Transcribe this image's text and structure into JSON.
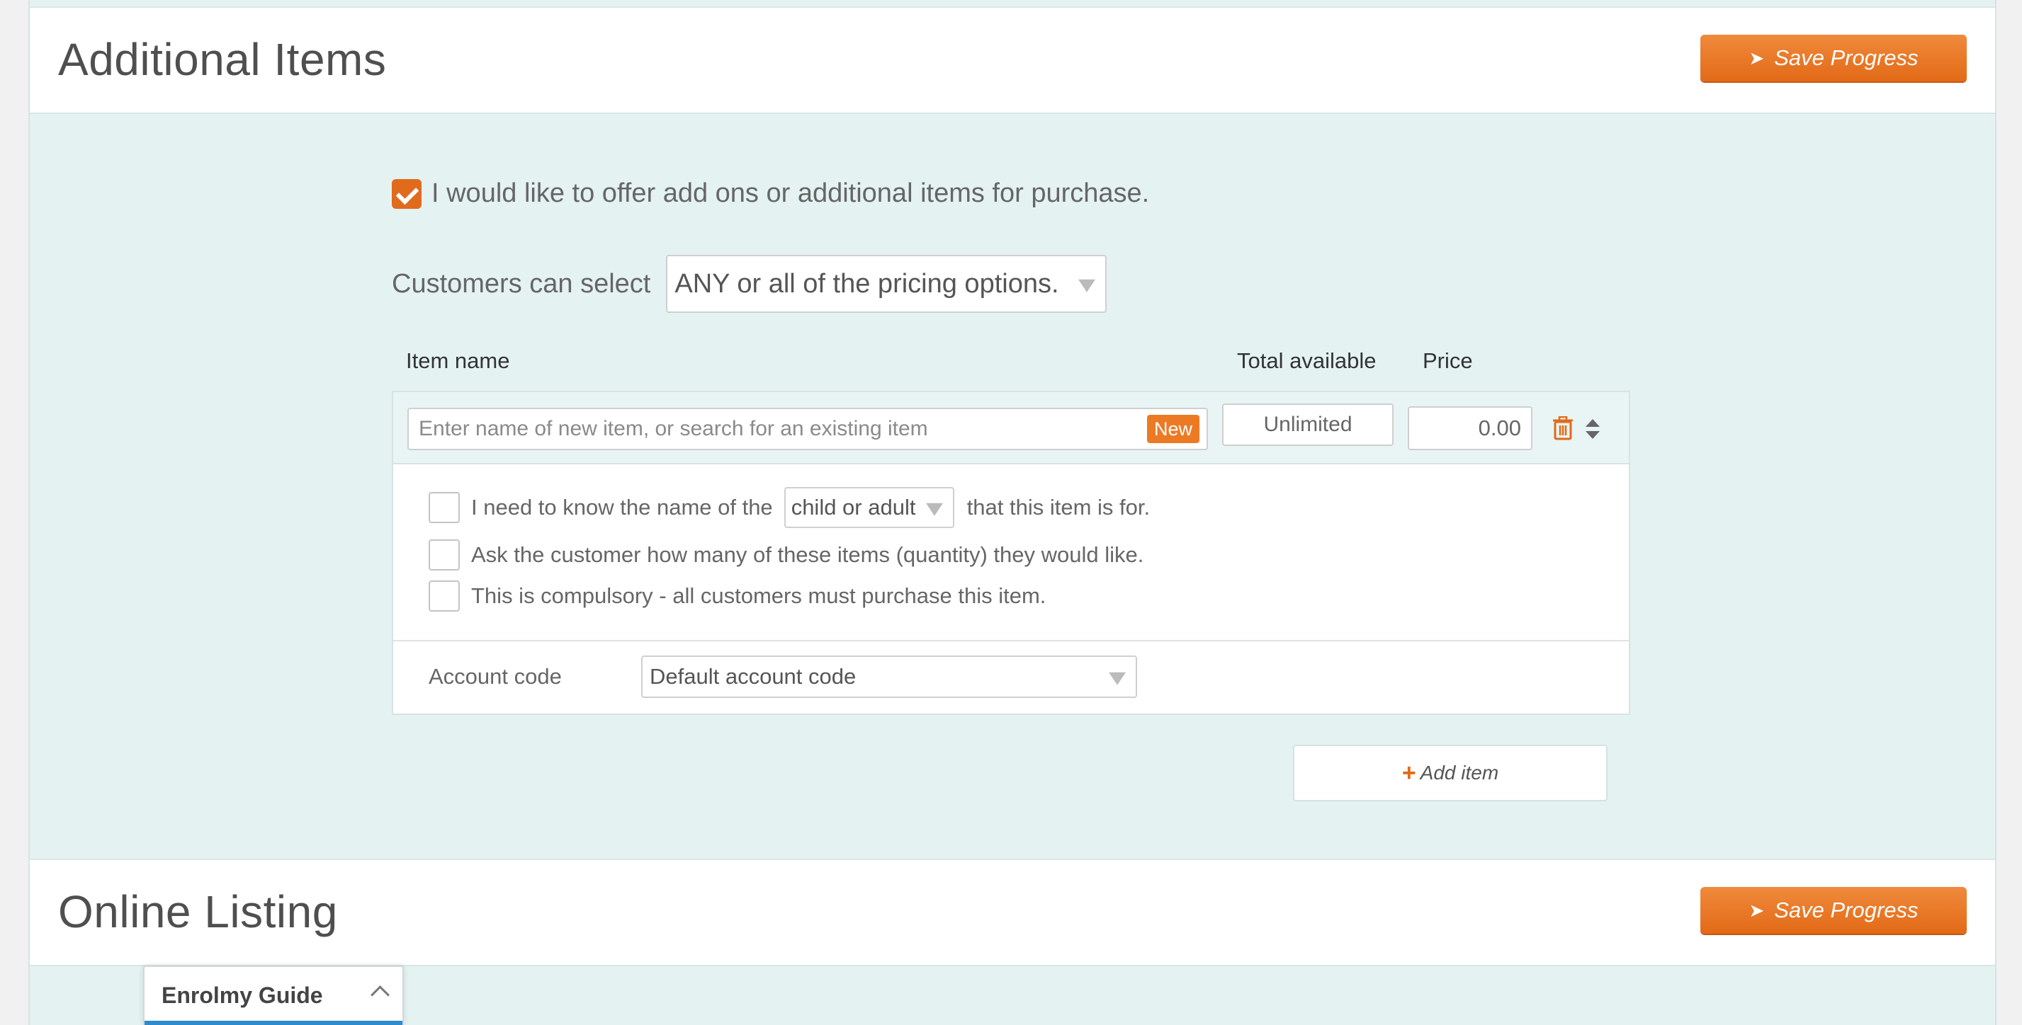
{
  "additional_items": {
    "title": "Additional Items",
    "save_label": "Save Progress",
    "offer_checkbox_label": "I would like to offer add ons or additional items for purchase.",
    "offer_checked": true,
    "customers_label": "Customers can select",
    "pricing_option_selected": "ANY or all of the pricing options.",
    "columns": {
      "item_name": "Item name",
      "total_available": "Total available",
      "price": "Price"
    },
    "item": {
      "name_placeholder": "Enter name of new item, or search for an existing item",
      "new_badge": "New",
      "total_available": "Unlimited",
      "price": "0.00",
      "options": {
        "name_prefix": "I need to know the name of the",
        "name_select_value": "child or adult",
        "name_suffix": "that this item is for.",
        "quantity": "Ask the customer how many of these items (quantity) they would like.",
        "compulsory": "This is compulsory - all customers must purchase this item."
      },
      "account_code_label": "Account code",
      "account_code_value": "Default account code"
    },
    "add_item_label": "Add item"
  },
  "online_listing": {
    "title": "Online Listing",
    "save_label": "Save Progress"
  },
  "guide": {
    "label": "Enrolmy Guide"
  },
  "colors": {
    "accent": "#e26a17",
    "panel_bg": "#e4f2f2",
    "guide_bar": "#2d8bd0"
  }
}
